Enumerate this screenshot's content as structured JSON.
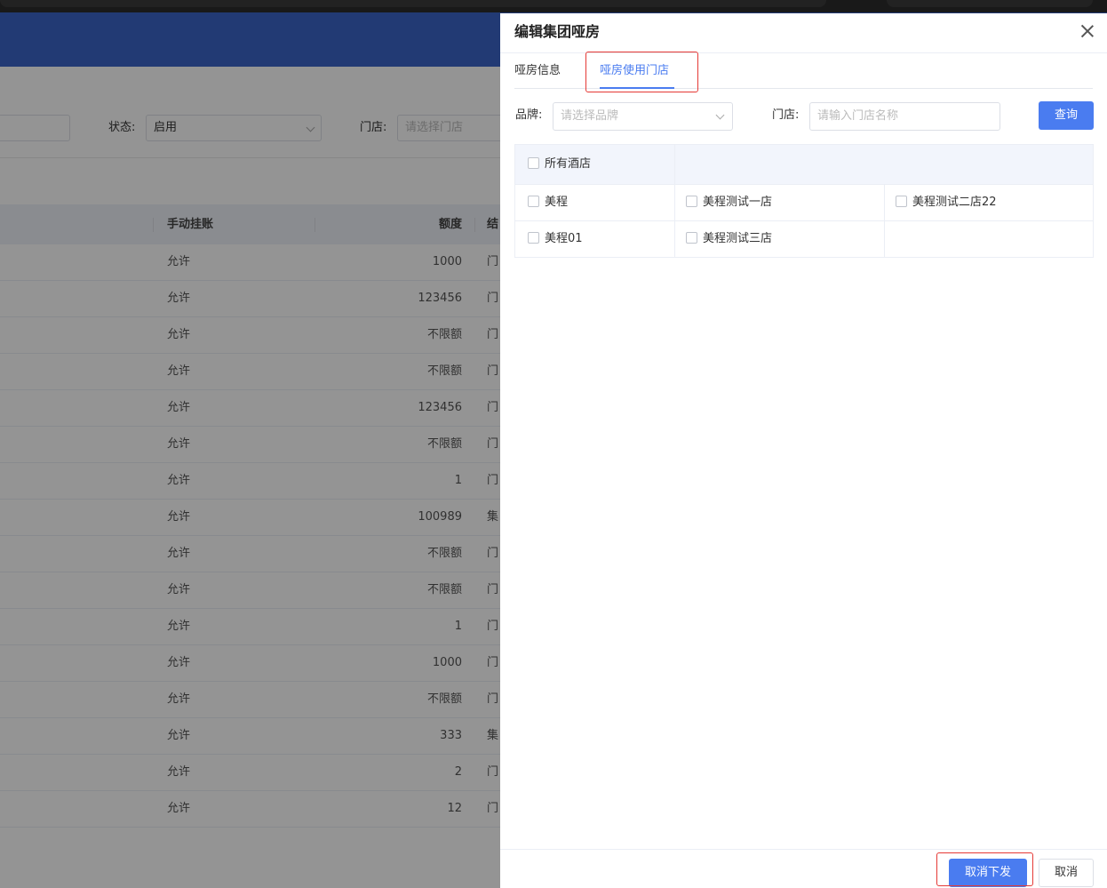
{
  "background": {
    "filter": {
      "status_label": "状态:",
      "status_value": "启用",
      "store_label": "门店:",
      "store_placeholder": "请选择门店"
    },
    "table": {
      "headers": [
        "手动挂账",
        "额度",
        "结"
      ],
      "rows": [
        {
          "manual": "允许",
          "quota": "1000",
          "settle": "门"
        },
        {
          "manual": "允许",
          "quota": "123456",
          "settle": "门"
        },
        {
          "manual": "允许",
          "quota": "不限额",
          "settle": "门"
        },
        {
          "manual": "允许",
          "quota": "不限额",
          "settle": "门"
        },
        {
          "manual": "允许",
          "quota": "123456",
          "settle": "门"
        },
        {
          "manual": "允许",
          "quota": "不限额",
          "settle": "门"
        },
        {
          "manual": "允许",
          "quota": "1",
          "settle": "门"
        },
        {
          "manual": "允许",
          "quota": "100989",
          "settle": "集"
        },
        {
          "manual": "允许",
          "quota": "不限额",
          "settle": "门"
        },
        {
          "manual": "允许",
          "quota": "不限额",
          "settle": "门"
        },
        {
          "manual": "允许",
          "quota": "1",
          "settle": "门"
        },
        {
          "manual": "允许",
          "quota": "1000",
          "settle": "门"
        },
        {
          "manual": "允许",
          "quota": "不限额",
          "settle": "门"
        },
        {
          "manual": "允许",
          "quota": "333",
          "settle": "集"
        },
        {
          "manual": "允许",
          "quota": "2",
          "settle": "门"
        },
        {
          "manual": "允许",
          "quota": "12",
          "settle": "门"
        }
      ]
    }
  },
  "drawer": {
    "title": "编辑集团哑房",
    "tabs": [
      {
        "label": "哑房信息",
        "active": false
      },
      {
        "label": "哑房使用门店",
        "active": true
      }
    ],
    "filters": {
      "brand_label": "品牌:",
      "brand_placeholder": "请选择品牌",
      "store_label": "门店:",
      "store_placeholder": "请输入门店名称",
      "query_button": "查询"
    },
    "grid": {
      "all_label": "所有酒店",
      "rows": [
        {
          "brand": "美程",
          "stores": [
            "美程测试一店",
            "美程测试二店22"
          ]
        },
        {
          "brand": "美程01",
          "stores": [
            "美程测试三店"
          ]
        }
      ]
    },
    "footer": {
      "revoke_button": "取消下发",
      "cancel_button": "取消"
    }
  },
  "colors": {
    "primary": "#4a7cf0",
    "header_blue": "#3c64c8",
    "highlight_red": "#e53935"
  }
}
